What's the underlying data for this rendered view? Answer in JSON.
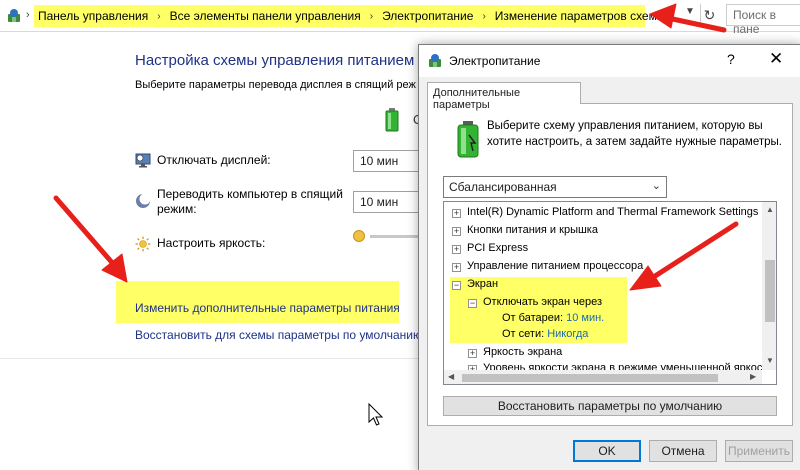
{
  "address_bar": {
    "breadcrumbs": [
      "Панель управления",
      "Все элементы панели управления",
      "Электропитание",
      "Изменение параметров схемы"
    ],
    "search_placeholder": "Поиск в пане"
  },
  "main": {
    "title": "Настройка схемы управления питанием \"",
    "subtitle": "Выберите параметры перевода дисплея в спящий реж",
    "battery_column_partial": "О",
    "rows": [
      {
        "label": "Отключать дисплей:",
        "value": "10 мин"
      },
      {
        "label": "Переводить компьютер в спящий\nрежим:",
        "value": "10 мин"
      },
      {
        "label": "Настроить яркость:"
      }
    ],
    "link_advanced": "Изменить дополнительные параметры питания",
    "link_restore": "Восстановить для схемы параметры по умолчанию"
  },
  "dialog": {
    "title": "Электропитание",
    "help_glyph": "?",
    "close_glyph": "✕",
    "tab": "Дополнительные параметры",
    "description": "Выберите схему управления питанием, которую вы хотите настроить, а затем задайте нужные параметры.",
    "scheme_selected": "Сбалансированная",
    "tree": [
      {
        "label": "Intel(R) Dynamic Platform and Thermal Framework Settings",
        "toggle": "+"
      },
      {
        "label": "Кнопки питания и крышка",
        "toggle": "+"
      },
      {
        "label": "PCI Express",
        "toggle": "+"
      },
      {
        "label": "Управление питанием процессора",
        "toggle": "+"
      },
      {
        "label": "Экран",
        "toggle": "−"
      },
      {
        "label": "Отключать экран через",
        "toggle": "−"
      },
      {
        "label": "От батареи:",
        "value": "10 мин."
      },
      {
        "label": "От сети:",
        "value": "Никогда"
      },
      {
        "label": "Яркость экрана",
        "toggle": "+"
      },
      {
        "label": "Уровень яркости экрана в режиме уменьшенной яркости",
        "toggle": "+"
      }
    ],
    "restore_defaults": "Восстановить параметры по умолчанию",
    "ok": "OK",
    "cancel": "Отмена",
    "apply": "Применить"
  },
  "colors": {
    "highlight": "#ffff66",
    "link": "#1e3287",
    "annotation_arrow": "#e8201a",
    "ok_border": "#0078d7"
  }
}
